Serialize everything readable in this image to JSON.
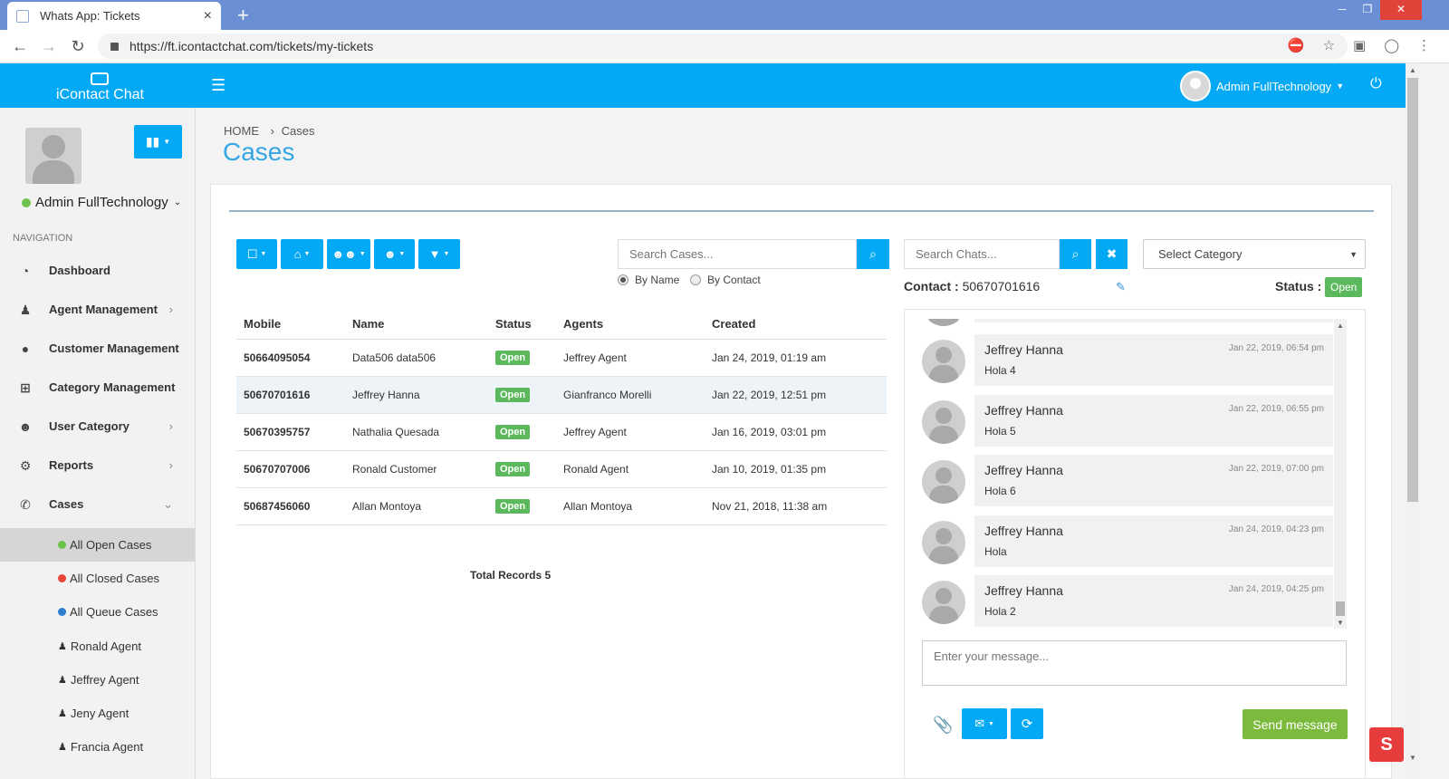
{
  "browser": {
    "tab_title": "Whats App: Tickets",
    "url": "https://ft.icontactchat.com/tickets/my-tickets"
  },
  "header": {
    "logo_text": "iContact Chat",
    "user_name": "Admin FullTechnology"
  },
  "sidebar": {
    "user_name": "Admin FullTechnology",
    "nav_heading": "NAVIGATION",
    "items": [
      {
        "label": "Dashboard",
        "icon": "dashboard-icon"
      },
      {
        "label": "Agent Management",
        "icon": "agent-icon"
      },
      {
        "label": "Customer Management",
        "icon": "user-icon"
      },
      {
        "label": "Category Management",
        "icon": "sitemap-icon"
      },
      {
        "label": "User Category",
        "icon": "users-icon"
      },
      {
        "label": "Reports",
        "icon": "cogs-icon"
      },
      {
        "label": "Cases",
        "icon": "whatsapp-icon"
      }
    ],
    "subitems": [
      {
        "label": "All Open Cases",
        "color": "#6cc24a"
      },
      {
        "label": "All Closed Cases",
        "color": "#e8463a"
      },
      {
        "label": "All Queue Cases",
        "color": "#2f7fd0"
      },
      {
        "label": "Ronald Agent"
      },
      {
        "label": "Jeffrey Agent"
      },
      {
        "label": "Jeny Agent"
      },
      {
        "label": "Francia Agent"
      }
    ]
  },
  "breadcrumb": {
    "home": "HOME",
    "current": "Cases"
  },
  "page_title": "Cases",
  "search_cases": {
    "placeholder": "Search Cases...",
    "by_name": "By Name",
    "by_contact": "By Contact"
  },
  "search_chats": {
    "placeholder": "Search Chats..."
  },
  "category_select": {
    "value": "Select Category"
  },
  "table": {
    "headers": [
      "Mobile",
      "Name",
      "Status",
      "Agents",
      "Created"
    ],
    "rows": [
      {
        "mobile": "50664095054",
        "name": "Data506 data506",
        "status": "Open",
        "agent": "Jeffrey Agent",
        "created": "Jan 24, 2019, 01:19 am"
      },
      {
        "mobile": "50670701616",
        "name": "Jeffrey Hanna",
        "status": "Open",
        "agent": "Gianfranco Morelli",
        "created": "Jan 22, 2019, 12:51 pm"
      },
      {
        "mobile": "50670395757",
        "name": "Nathalia Quesada",
        "status": "Open",
        "agent": "Jeffrey Agent",
        "created": "Jan 16, 2019, 03:01 pm"
      },
      {
        "mobile": "50670707006",
        "name": "Ronald Customer",
        "status": "Open",
        "agent": "Ronald Agent",
        "created": "Jan 10, 2019, 01:35 pm"
      },
      {
        "mobile": "50687456060",
        "name": "Allan Montoya",
        "status": "Open",
        "agent": "Allan Montoya",
        "created": "Nov 21, 2018, 11:38 am"
      }
    ],
    "total": "Total Records 5"
  },
  "chat": {
    "contact_label": "Contact :",
    "contact_value": "50670701616",
    "status_label": "Status :",
    "status_value": "Open",
    "messages": [
      {
        "sender": "Jeffrey Hanna",
        "time": "Jan 22, 2019, 06:54 pm",
        "text": "Hola 4"
      },
      {
        "sender": "Jeffrey Hanna",
        "time": "Jan 22, 2019, 06:55 pm",
        "text": "Hola 5"
      },
      {
        "sender": "Jeffrey Hanna",
        "time": "Jan 22, 2019, 07:00 pm",
        "text": "Hola 6"
      },
      {
        "sender": "Jeffrey Hanna",
        "time": "Jan 24, 2019, 04:23 pm",
        "text": "Hola"
      },
      {
        "sender": "Jeffrey Hanna",
        "time": "Jan 24, 2019, 04:25 pm",
        "text": "Hola 2"
      }
    ],
    "input_placeholder": "Enter your message...",
    "send_label": "Send message"
  },
  "colors": {
    "primary": "#03a9f4",
    "open_badge": "#5cb85c",
    "send": "#7cba3d"
  }
}
